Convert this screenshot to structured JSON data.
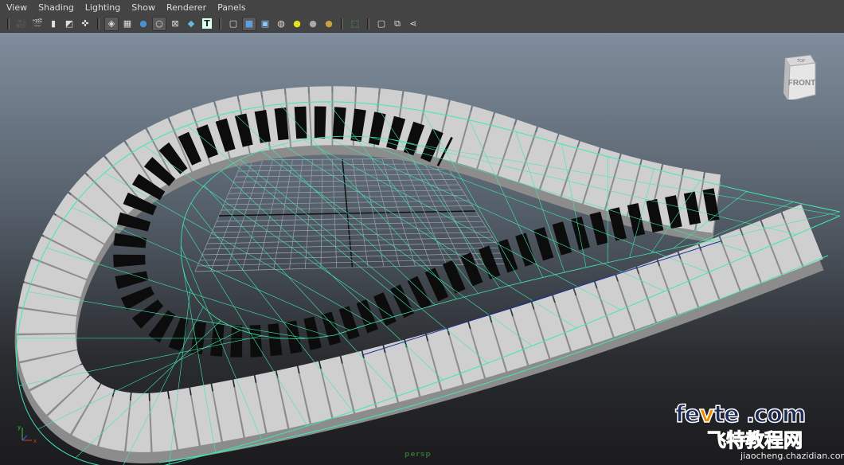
{
  "menu": [
    "View",
    "Shading",
    "Lighting",
    "Show",
    "Renderer",
    "Panels"
  ],
  "toolbar": {
    "groups": [
      [
        "camera-attributes-icon",
        "camera-select-icon",
        "bookmark-icon",
        "image-plane-icon",
        "2d-pan-zoom-icon"
      ],
      [
        "grid-icon",
        "film-gate-icon",
        "resolution-gate-icon",
        "safe-action-icon",
        "field-chart-icon",
        "safe-title-icon",
        "texture-icon"
      ],
      [
        "wireframe-icon",
        "smooth-shade-icon",
        "wireframe-on-shaded-icon",
        "textured-icon",
        "use-all-lights-icon",
        "shadows-icon",
        "default-light-icon"
      ],
      [
        "isolate-select-icon"
      ],
      [
        "xray-icon",
        "xray-joints-icon",
        "share-icon"
      ]
    ]
  },
  "viewport": {
    "camera_label": "persp",
    "viewcube_label": "FRONT",
    "viewcube_top": "TOP",
    "wireframe_color": "#3fe8b0",
    "axis": {
      "x": "x",
      "y": "y",
      "z": "z"
    }
  },
  "watermark": {
    "line1_a": "fe",
    "line1_v": "v",
    "line1_b": "te .com",
    "line2": "飞特教程网",
    "line3": "jiaocheng.chazidian.com"
  }
}
